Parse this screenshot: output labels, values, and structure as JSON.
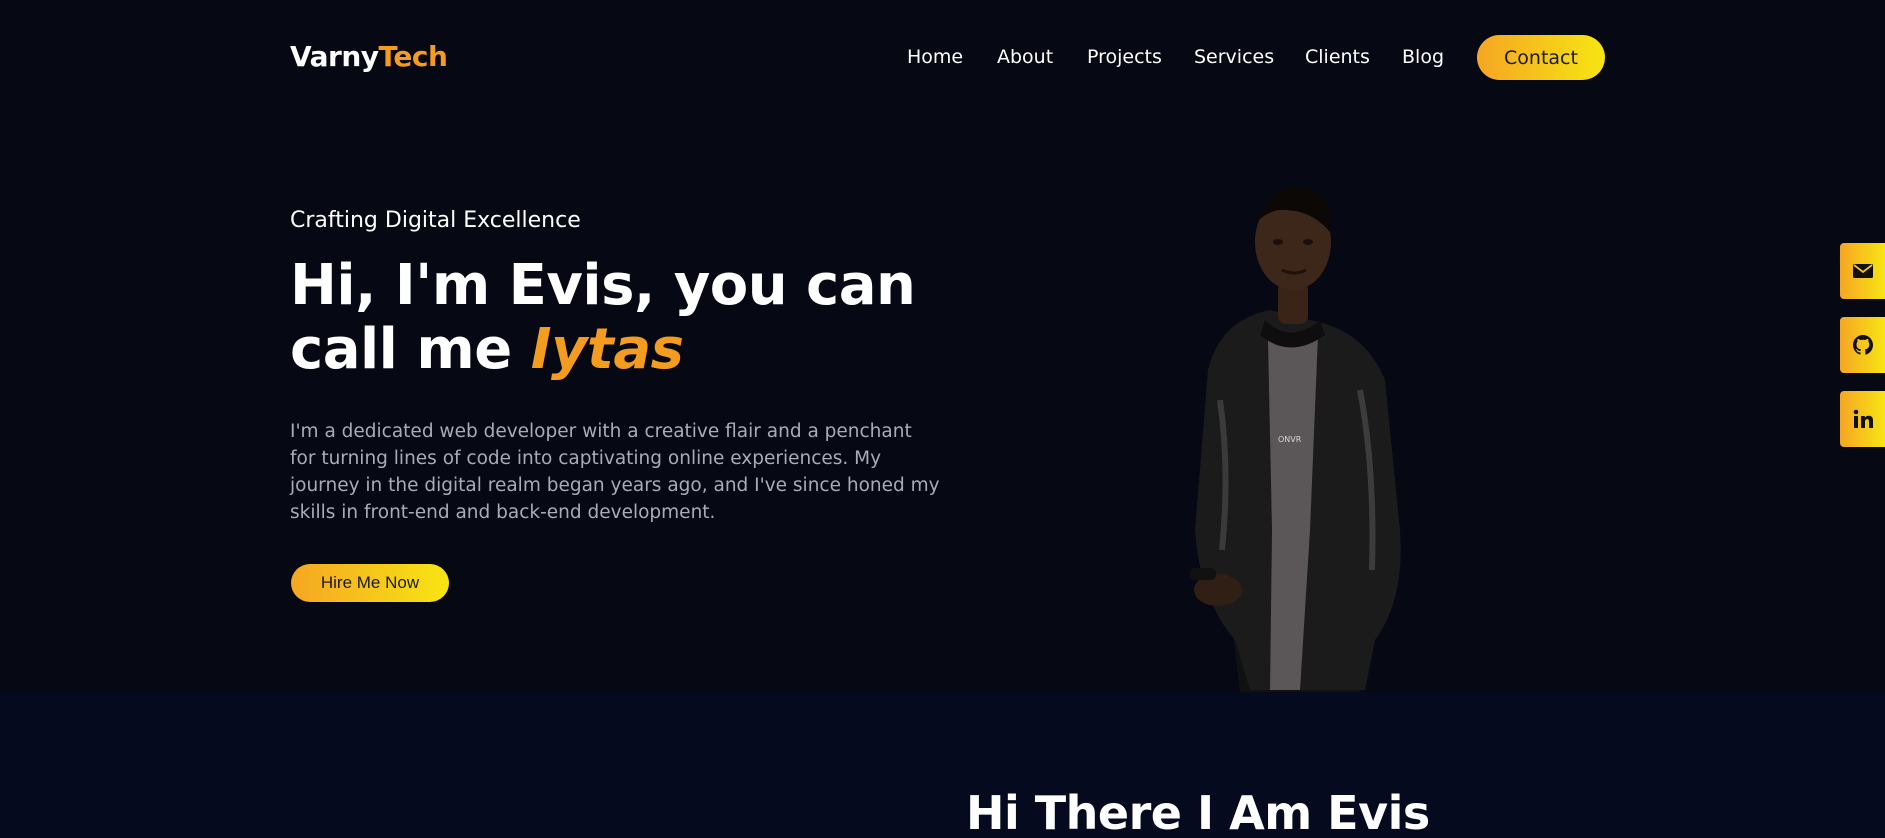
{
  "brand": {
    "name_part1": "Varny",
    "name_part2": "Tech"
  },
  "nav": {
    "items": [
      "Home",
      "About",
      "Projects",
      "Services",
      "Clients",
      "Blog"
    ],
    "contact_label": "Contact"
  },
  "hero": {
    "kicker": "Crafting Digital Excellence",
    "headline_line1": "Hi, I'm Evis, you can",
    "headline_line2_prefix": "call me",
    "headline_accent": "Iytas",
    "intro": "I'm a dedicated web developer with a creative flair and a penchant for turning lines of code into captivating online experiences. My journey in the digital realm began years ago, and I've since honed my skills in front-end and back-end development.",
    "cta_label": "Hire Me Now"
  },
  "social": [
    {
      "icon": "mail-icon"
    },
    {
      "icon": "github-icon"
    },
    {
      "icon": "linkedin-icon"
    }
  ],
  "about": {
    "title": "Hi There I Am Evis"
  },
  "colors": {
    "background": "#060814",
    "accent": "#f39c1f",
    "gradient_start": "#f5a623",
    "gradient_end": "#f7e512",
    "muted_text": "#a9abb8"
  }
}
